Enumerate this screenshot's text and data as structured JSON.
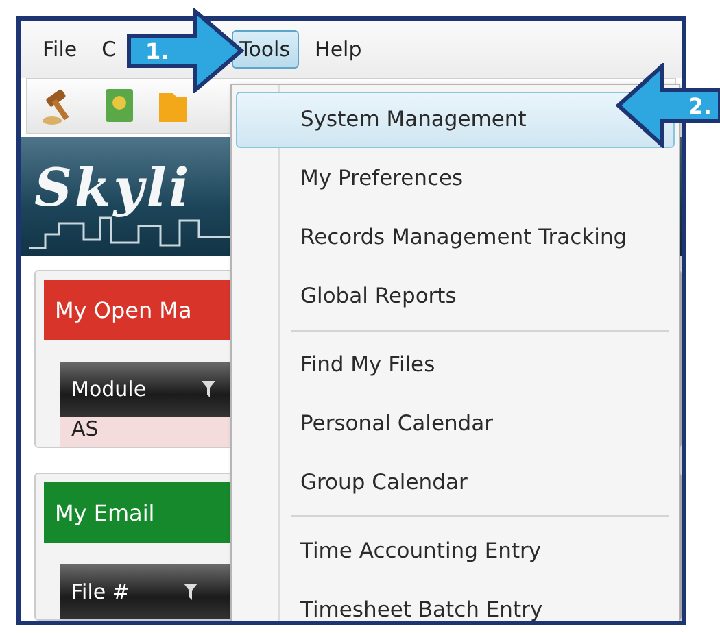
{
  "menu_bar": [
    {
      "label": "File",
      "selected": false
    },
    {
      "label": "C",
      "selected": false
    },
    {
      "label": "Tools",
      "selected": true
    },
    {
      "label": "Help",
      "selected": false
    }
  ],
  "banner": {
    "logo": "Skyli"
  },
  "panels": [
    {
      "title": "My Open Ma",
      "color": "#d8342a",
      "header": "Module",
      "cell": "AS"
    },
    {
      "title": "My Email",
      "color": "#15892c",
      "header": "File #"
    }
  ],
  "dropdown": {
    "groups": [
      [
        {
          "label": "System Management",
          "selected": true
        },
        {
          "label": "My Preferences",
          "selected": false
        },
        {
          "label": "Records Management Tracking",
          "selected": false
        },
        {
          "label": "Global Reports",
          "selected": false
        }
      ],
      [
        {
          "label": "Find My Files",
          "selected": false
        },
        {
          "label": "Personal Calendar",
          "selected": false
        },
        {
          "label": "Group Calendar",
          "selected": false
        }
      ],
      [
        {
          "label": "Time Accounting Entry",
          "selected": false
        },
        {
          "label": "Timesheet Batch Entry",
          "selected": false
        }
      ]
    ]
  },
  "callouts": [
    {
      "label": "1.",
      "kind": "right"
    },
    {
      "label": "2.",
      "kind": "left"
    }
  ]
}
